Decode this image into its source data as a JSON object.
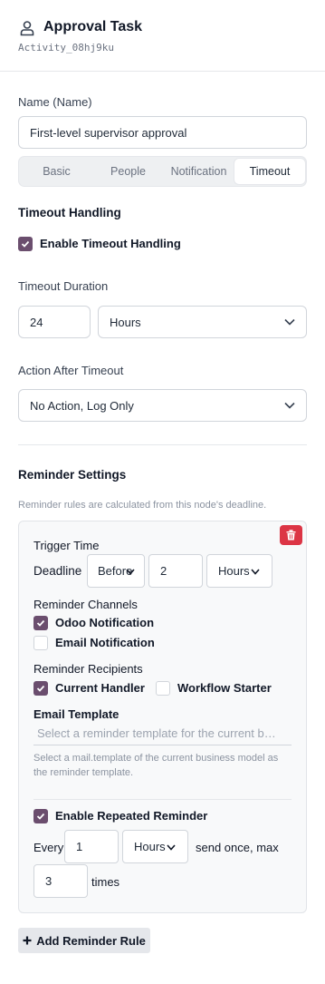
{
  "header": {
    "title": "Approval Task",
    "subtitle": "Activity_08hj9ku",
    "icon": "user-icon"
  },
  "name_field": {
    "label": "Name (Name)",
    "value": "First-level supervisor approval"
  },
  "tabs": [
    {
      "label": "Basic",
      "active": false
    },
    {
      "label": "People",
      "active": false
    },
    {
      "label": "Notification",
      "active": false
    },
    {
      "label": "Timeout",
      "active": true
    }
  ],
  "timeout": {
    "section_title": "Timeout Handling",
    "enable_label": "Enable Timeout Handling",
    "enabled": true,
    "duration_label": "Timeout Duration",
    "duration_value": "24",
    "duration_unit": "Hours",
    "action_label": "Action After Timeout",
    "action_value": "No Action, Log Only"
  },
  "reminder": {
    "section_title": "Reminder Settings",
    "hint": "Reminder rules are calculated from this node's deadline.",
    "rule": {
      "trigger_label": "Trigger Time",
      "deadline_label": "Deadline",
      "before_value": "Before",
      "offset_value": "2",
      "offset_unit": "Hours",
      "channels_label": "Reminder Channels",
      "channels": [
        {
          "label": "Odoo Notification",
          "checked": true
        },
        {
          "label": "Email Notification",
          "checked": false
        }
      ],
      "recipients_label": "Reminder Recipients",
      "recipients": [
        {
          "label": "Current Handler",
          "checked": true
        },
        {
          "label": "Workflow Starter",
          "checked": false
        }
      ],
      "template_label": "Email Template",
      "template_placeholder": "Select a reminder template for the current business model",
      "template_hint": "Select a mail.template of the current business model as the reminder template.",
      "repeat_label": "Enable Repeated Reminder",
      "repeat_enabled": true,
      "every_label": "Every",
      "every_value": "1",
      "every_unit": "Hours",
      "send_label": "send once, max",
      "max_value": "3",
      "times_label": "times"
    },
    "add_label": "Add Reminder Rule"
  },
  "colors": {
    "accent": "#6b4e6e",
    "danger": "#dc3545"
  }
}
